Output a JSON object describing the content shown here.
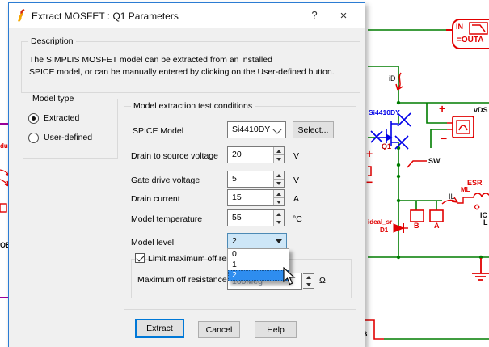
{
  "dialog": {
    "title": "Extract MOSFET : Q1 Parameters",
    "help": "?",
    "close": "×",
    "description": {
      "label": "Description",
      "line1": "The SIMPLIS MOSFET model can be extracted from an installed",
      "line2": "SPICE model, or can be manually entered by clicking on the User-defined button."
    },
    "model_type": {
      "label": "Model type",
      "extracted": "Extracted",
      "user_defined": "User-defined"
    },
    "conditions": {
      "label": "Model extraction test conditions",
      "spice_model_label": "SPICE Model",
      "spice_model_value": "Si4410DY",
      "select_button": "Select...",
      "rows": [
        {
          "label": "Drain to source voltage",
          "value": "20",
          "unit": "V"
        },
        {
          "label": "Gate drive voltage",
          "value": "5",
          "unit": "V"
        },
        {
          "label": "Drain current",
          "value": "15",
          "unit": "A"
        },
        {
          "label": "Model temperature",
          "value": "55",
          "unit": "°C"
        }
      ],
      "model_level_label": "Model level",
      "model_level_value": "2",
      "dropdown_options": [
        "0",
        "1",
        "2"
      ],
      "dropdown_highlighted": "2",
      "limit_checkbox_label": "Limit maximum off resistance",
      "max_off_label": "Maximum off resistance",
      "max_off_value": "100Meg",
      "max_off_unit": "Ω"
    },
    "buttons": {
      "extract": "Extract",
      "cancel": "Cancel",
      "help": "Help"
    }
  },
  "schematic": {
    "out_in": "IN",
    "out_name": "=OUTA",
    "id_probe": "iD",
    "mosfet_model": "Si4410DY",
    "mosfet_ref": "Q1",
    "vds_label": "vDS",
    "plus_top": "+",
    "minus_top": "−",
    "plus_left": "+",
    "minus_left": "−",
    "sw_label": "SW",
    "esr_label": "ESR",
    "ml_label": "ML",
    "il_label": "IL",
    "ic_label": "IC",
    "l_label": "L",
    "b_port": "B",
    "a_port": "A",
    "ideal_sr": "ideal_sr",
    "d1": "D1",
    "b_bottom": "B",
    "ob_label": "OB",
    "duc_label": "duc"
  },
  "colors": {
    "accent": "#0078d7",
    "wire_green": "#007d00",
    "component_red": "#e10000",
    "mosfet_blue": "#0000e8",
    "highlight": "#2e8def",
    "purple": "#990099"
  }
}
